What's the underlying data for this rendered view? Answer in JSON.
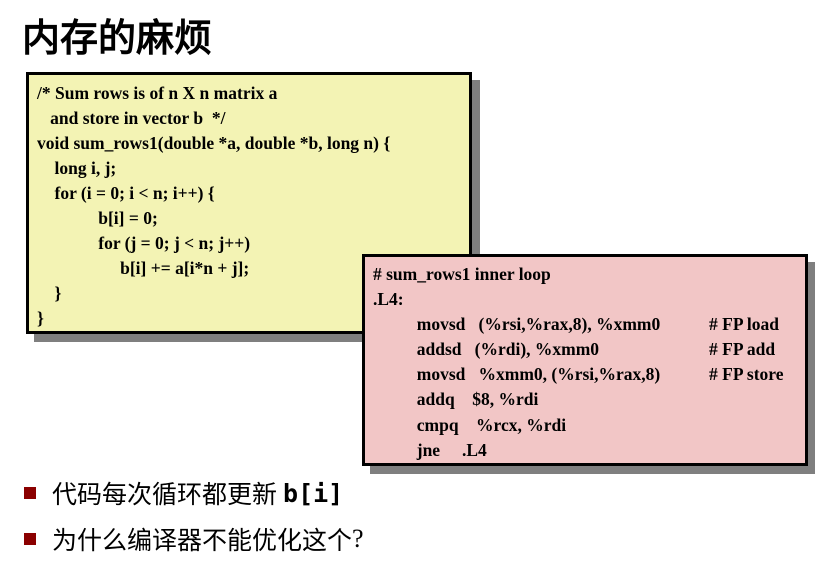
{
  "title": "内存的麻烦",
  "c_code": {
    "lines": [
      "/* Sum rows is of n X n matrix a",
      "   and store in vector b  */",
      "void sum_rows1(double *a, double *b, long n) {",
      "    long i, j;",
      "    for (i = 0; i < n; i++) {",
      "              b[i] = 0;",
      "              for (j = 0; j < n; j++)",
      "                   b[i] += a[i*n + j];",
      "    }",
      "}"
    ]
  },
  "asm_code": {
    "lines": [
      {
        "code": "# sum_rows1 inner loop",
        "comment": ""
      },
      {
        "code": ".L4:",
        "comment": ""
      },
      {
        "code": "          movsd   (%rsi,%rax,8), %xmm0",
        "comment": "# FP load"
      },
      {
        "code": "          addsd   (%rdi), %xmm0",
        "comment": "# FP add"
      },
      {
        "code": "          movsd   %xmm0, (%rsi,%rax,8)",
        "comment": "# FP store"
      },
      {
        "code": "          addq    $8, %rdi",
        "comment": ""
      },
      {
        "code": "          cmpq    %rcx, %rdi",
        "comment": ""
      },
      {
        "code": "          jne     .L4",
        "comment": ""
      }
    ]
  },
  "bullets": [
    {
      "text": "代码每次循环都更新",
      "code": "b[i]",
      "suffix": ""
    },
    {
      "text": "为什么编译器不能优化这个",
      "code": "",
      "suffix": "?"
    }
  ],
  "colors": {
    "c_box_bg": "#f3f3b4",
    "asm_box_bg": "#f2c6c6",
    "bullet_marker": "#8b0000"
  }
}
